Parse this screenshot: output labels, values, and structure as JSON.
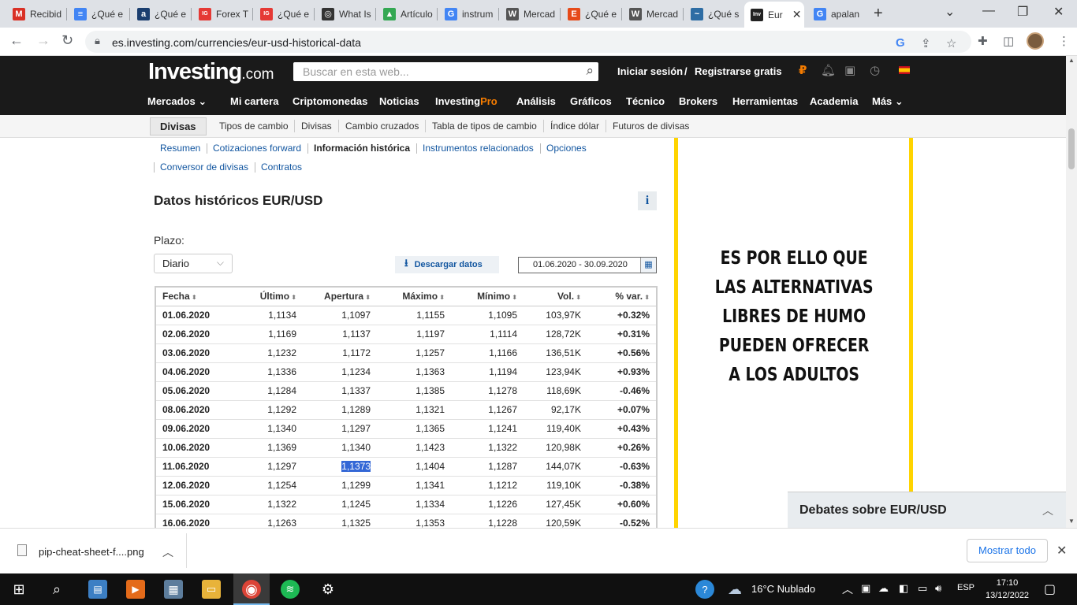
{
  "browser": {
    "tabs": [
      {
        "label": "Recibid",
        "icon": "gmail-icon",
        "color": "#d93025",
        "glyph": "M"
      },
      {
        "label": "¿Qué e",
        "icon": "docs-icon",
        "color": "#4285f4",
        "glyph": "≡"
      },
      {
        "label": "¿Qué e",
        "icon": "a-icon",
        "color": "#1b3e6f",
        "glyph": "a"
      },
      {
        "label": "Forex T",
        "icon": "ig-icon",
        "color": "#e53935",
        "glyph": "IG"
      },
      {
        "label": "¿Qué e",
        "icon": "ig-icon",
        "color": "#e53935",
        "glyph": "IG"
      },
      {
        "label": "What Is",
        "icon": "circle-icon",
        "color": "#333333",
        "glyph": "◎"
      },
      {
        "label": "Artículo",
        "icon": "drive-icon",
        "color": "#34a853",
        "glyph": "▲"
      },
      {
        "label": "instrum",
        "icon": "google-icon",
        "color": "#4285f4",
        "glyph": "G"
      },
      {
        "label": "Mercad",
        "icon": "wikipedia-icon",
        "color": "#555555",
        "glyph": "W"
      },
      {
        "label": "¿Qué e",
        "icon": "e-icon",
        "color": "#e64a19",
        "glyph": "E"
      },
      {
        "label": "Mercad",
        "icon": "wikipedia-icon",
        "color": "#555555",
        "glyph": "W"
      },
      {
        "label": "¿Qué s",
        "icon": "wave-icon",
        "color": "#2e6da4",
        "glyph": "~"
      },
      {
        "label": "Eur",
        "icon": "investing-icon",
        "color": "#222222",
        "glyph": "Inv",
        "active": true
      },
      {
        "label": "apalan",
        "icon": "google-icon",
        "color": "#4285f4",
        "glyph": "G"
      }
    ],
    "url": "es.investing.com/currencies/eur-usd-historical-data"
  },
  "site": {
    "logo_main": "Investing",
    "logo_suffix": ".com",
    "search_placeholder": "Buscar en esta web...",
    "login": "Iniciar sesión",
    "slash": "/",
    "register": "Registrarse gratis",
    "nav": [
      "Mercados",
      "Mi cartera",
      "Criptomonedas",
      "Noticias",
      "Investing",
      "Pro",
      "Análisis",
      "Gráficos",
      "Técnico",
      "Brokers",
      "Herramientas",
      "Academia",
      "Más"
    ],
    "subnav": [
      "Divisas",
      "Tipos de cambio",
      "Divisas",
      "Cambio cruzados",
      "Tabla de tipos de cambio",
      "Índice dólar",
      "Futuros de divisas"
    ]
  },
  "section_links": [
    "Resumen",
    "Cotizaciones forward",
    "Información histórica",
    "Instrumentos relacionados",
    "Opciones",
    "Conversor de divisas",
    "Contratos"
  ],
  "main": {
    "title": "Datos históricos EUR/USD",
    "info": "i",
    "plazo_label": "Plazo:",
    "plazo_value": "Diario",
    "download": "Descargar datos",
    "date_range": "01.06.2020 - 30.09.2020"
  },
  "table": {
    "headers": [
      "Fecha",
      "Último",
      "Apertura",
      "Máximo",
      "Mínimo",
      "Vol.",
      "% var."
    ],
    "rows": [
      [
        "01.06.2020",
        "1,1134",
        "1,1097",
        "1,1155",
        "1,1095",
        "103,97K",
        "+0.32%"
      ],
      [
        "02.06.2020",
        "1,1169",
        "1,1137",
        "1,1197",
        "1,1114",
        "128,72K",
        "+0.31%"
      ],
      [
        "03.06.2020",
        "1,1232",
        "1,1172",
        "1,1257",
        "1,1166",
        "136,51K",
        "+0.56%"
      ],
      [
        "04.06.2020",
        "1,1336",
        "1,1234",
        "1,1363",
        "1,1194",
        "123,94K",
        "+0.93%"
      ],
      [
        "05.06.2020",
        "1,1284",
        "1,1337",
        "1,1385",
        "1,1278",
        "118,69K",
        "-0.46%"
      ],
      [
        "08.06.2020",
        "1,1292",
        "1,1289",
        "1,1321",
        "1,1267",
        "92,17K",
        "+0.07%"
      ],
      [
        "09.06.2020",
        "1,1340",
        "1,1297",
        "1,1365",
        "1,1241",
        "119,40K",
        "+0.43%"
      ],
      [
        "10.06.2020",
        "1,1369",
        "1,1340",
        "1,1423",
        "1,1322",
        "120,98K",
        "+0.26%"
      ],
      [
        "11.06.2020",
        "1,1297",
        "1,1373",
        "1,1404",
        "1,1287",
        "144,07K",
        "-0.63%"
      ],
      [
        "12.06.2020",
        "1,1254",
        "1,1299",
        "1,1341",
        "1,1212",
        "119,10K",
        "-0.38%"
      ],
      [
        "15.06.2020",
        "1,1322",
        "1,1245",
        "1,1334",
        "1,1226",
        "127,45K",
        "+0.60%"
      ],
      [
        "16.06.2020",
        "1,1263",
        "1,1325",
        "1,1353",
        "1,1228",
        "120,59K",
        "-0.52%"
      ]
    ],
    "selected_cell": "1,1373"
  },
  "ad": {
    "lines": [
      "ES POR ELLO QUE",
      "LAS ALTERNATIVAS",
      "LIBRES DE HUMO",
      "PUEDEN OFRECER",
      "A LOS ADULTOS"
    ]
  },
  "debates": {
    "title": "Debates sobre EUR/USD"
  },
  "downloads": {
    "filename": "pip-cheat-sheet-f....png",
    "show_all": "Mostrar todo"
  },
  "taskbar": {
    "weather": "16°C  Nublado",
    "lang": "ESP",
    "time": "17:10",
    "date": "13/12/2022"
  },
  "colors": {
    "up": "#0a9a0a",
    "down": "#e31414",
    "link": "#1256a0",
    "pro_accent": "#f57c00",
    "ad_border": "#ffd400"
  }
}
